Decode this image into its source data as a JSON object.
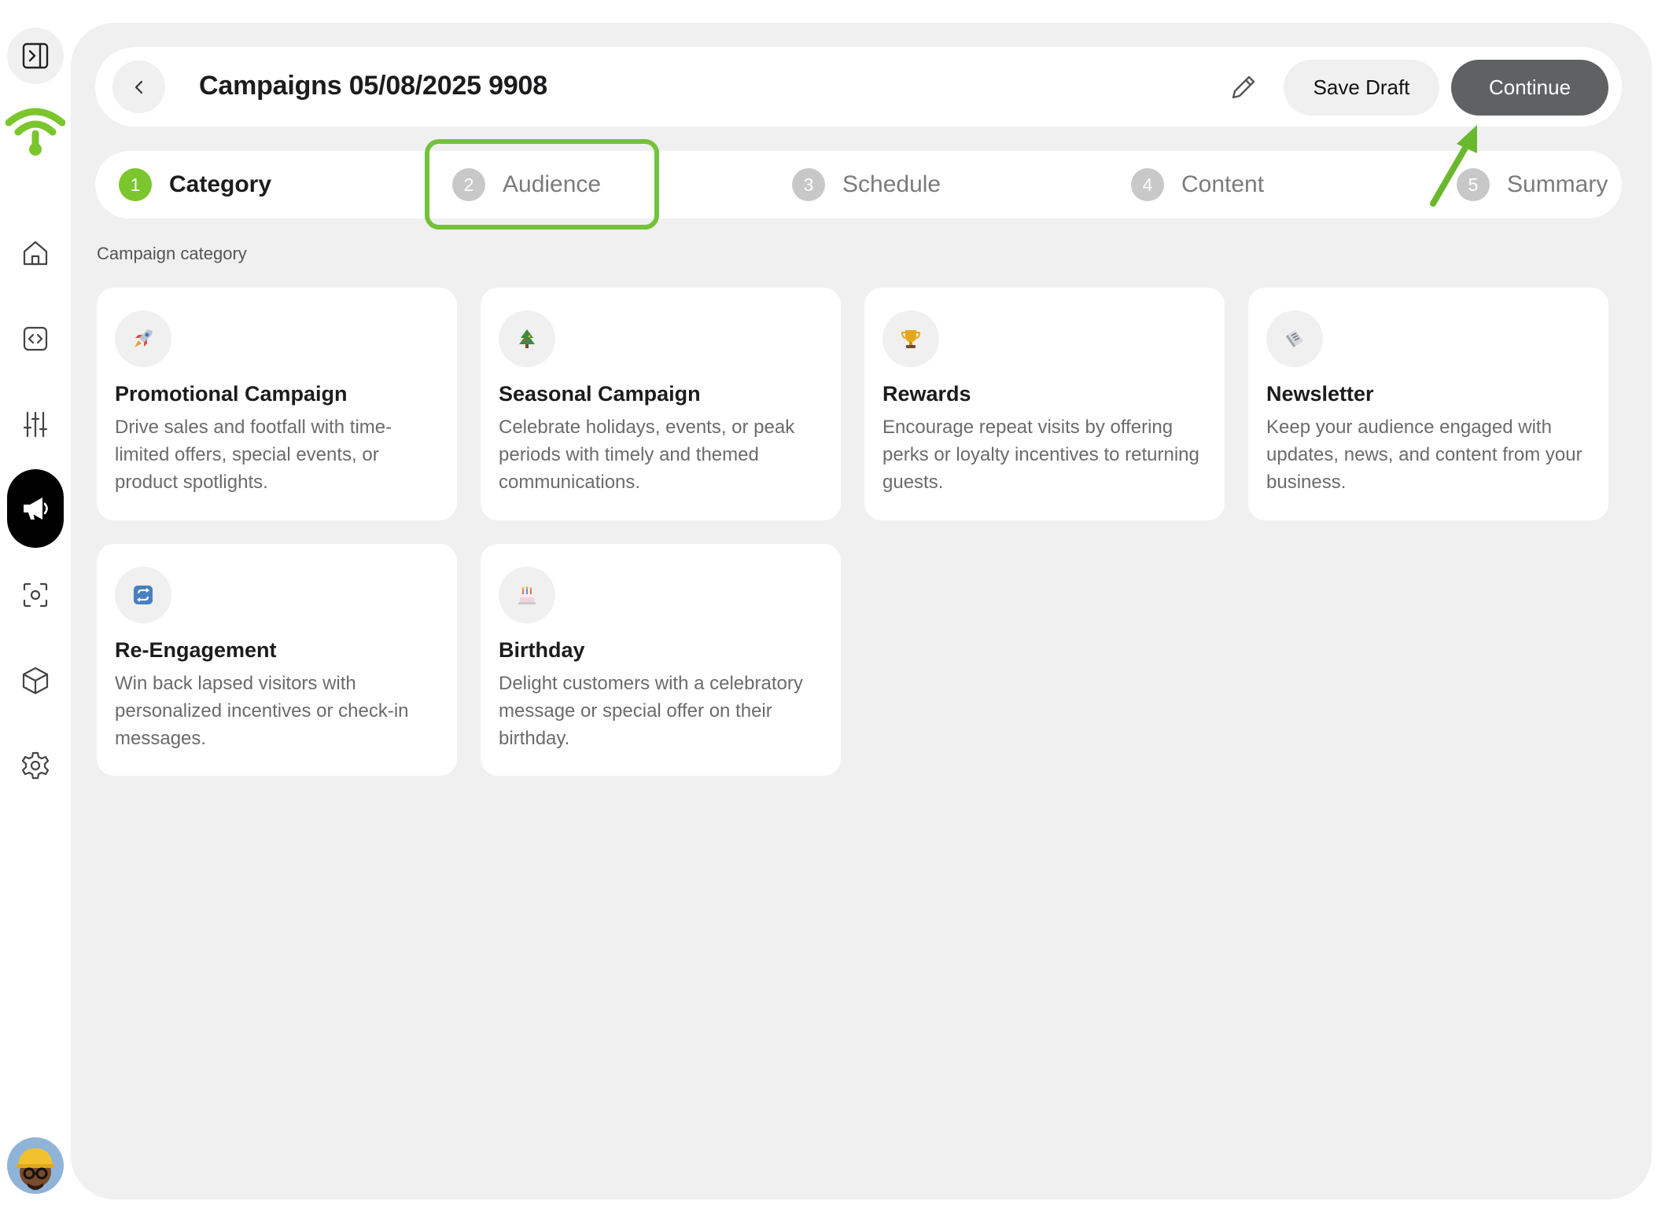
{
  "header": {
    "title": "Campaigns 05/08/2025 9908",
    "save_label": "Save Draft",
    "continue_label": "Continue"
  },
  "steps": [
    {
      "num": "1",
      "label": "Category",
      "active": true
    },
    {
      "num": "2",
      "label": "Audience",
      "active": false
    },
    {
      "num": "3",
      "label": "Schedule",
      "active": false
    },
    {
      "num": "4",
      "label": "Content",
      "active": false
    },
    {
      "num": "5",
      "label": "Summary",
      "active": false
    }
  ],
  "section": {
    "label": "Campaign category"
  },
  "categories": [
    {
      "icon": "rocket-icon",
      "title": "Promotional Campaign",
      "description": "Drive sales and footfall with time-limited offers, special events, or product spotlights."
    },
    {
      "icon": "christmas-tree-icon",
      "title": "Seasonal Campaign",
      "description": "Celebrate holidays, events, or peak periods with timely and themed communications."
    },
    {
      "icon": "trophy-icon",
      "title": "Rewards",
      "description": "Encourage repeat visits by offering perks or loyalty incentives to returning guests."
    },
    {
      "icon": "newspaper-icon",
      "title": "Newsletter",
      "description": "Keep your audience engaged with updates, news, and content from your business."
    },
    {
      "icon": "repeat-icon",
      "title": "Re-Engagement",
      "description": "Win back lapsed visitors with personalized incentives or check-in messages."
    },
    {
      "icon": "birthday-cake-icon",
      "title": "Birthday",
      "description": "Delight customers with a celebratory message or special offer on their birthday."
    }
  ],
  "colors": {
    "brand_green": "#7bc62d",
    "annotation_green": "#74c13a",
    "continue_bg": "#5f6163",
    "panel_bg": "#f0f0f0"
  },
  "sidebar": {
    "items": [
      "collapse-sidebar-icon",
      "home-icon",
      "code-icon",
      "sliders-icon",
      "megaphone-icon",
      "scan-icon",
      "box-icon",
      "settings-icon"
    ],
    "active": "megaphone-icon"
  }
}
